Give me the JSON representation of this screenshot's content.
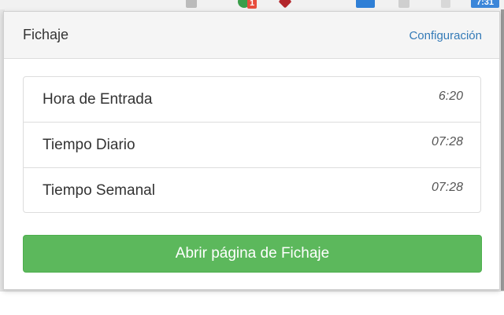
{
  "browser_toolbar": {
    "badge_count": "1",
    "clock_badge": "7:31"
  },
  "popup": {
    "title": "Fichaje",
    "config_link": "Configuración",
    "items": [
      {
        "label": "Hora de Entrada",
        "value": "6:20"
      },
      {
        "label": "Tiempo Diario",
        "value": "07:28"
      },
      {
        "label": "Tiempo Semanal",
        "value": "07:28"
      }
    ],
    "open_button": "Abrir página de Fichaje"
  },
  "colors": {
    "button_green": "#5cb85c",
    "link_blue": "#337ab7",
    "badge_red": "#e74c3c",
    "badge_blue": "#3b86d9"
  }
}
